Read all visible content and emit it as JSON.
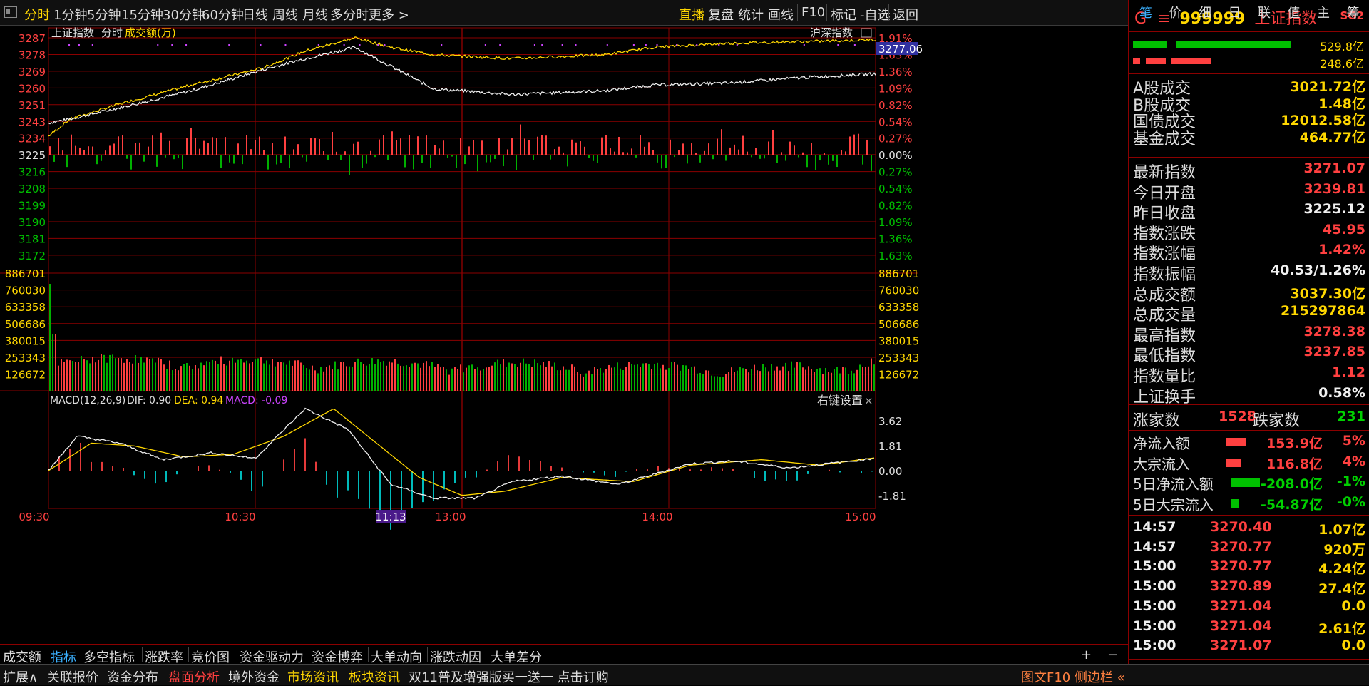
{
  "toolbar": {
    "periods": [
      "分时",
      "1分钟",
      "5分钟",
      "15分钟",
      "30分钟",
      "60分钟",
      "日线",
      "周线",
      "月线",
      "多分时",
      "更多 >"
    ],
    "right_buttons": [
      "直播",
      "复盘",
      "统计",
      "画线",
      "F10",
      "标记",
      "-自选",
      "返回"
    ]
  },
  "chart": {
    "index_name": "上证指数",
    "mode": "分时",
    "volume_label": "成交额(万)",
    "compare_label": "沪深指数",
    "current_price_tag": "3277.06",
    "price_ticks_left": [
      "3287",
      "3278",
      "3269",
      "3260",
      "3251",
      "3243",
      "3234",
      "3225",
      "3216",
      "3208",
      "3199",
      "3190",
      "3181",
      "3172"
    ],
    "pct_ticks_right": [
      "1.91%",
      "1.63%",
      "1.36%",
      "1.09%",
      "0.82%",
      "0.54%",
      "0.27%",
      "0.00%",
      "0.27%",
      "0.54%",
      "0.82%",
      "1.09%",
      "1.36%",
      "1.63%"
    ],
    "volume_ticks": [
      "886701",
      "760030",
      "633358",
      "506686",
      "380015",
      "253343",
      "126672"
    ],
    "macd_label": "MACD(12,26,9)",
    "macd_dif": "DIF: 0.90",
    "macd_dea": "DEA: 0.94",
    "macd_macd": "MACD: -0.09",
    "macd_settings": "右键设置",
    "macd_ticks": [
      "3.62",
      "1.81",
      "0.00",
      "-1.81"
    ],
    "time_labels": [
      "09:30",
      "10:30",
      "11:13",
      "13:00",
      "14:00",
      "15:00"
    ],
    "colors": {
      "up": "#ff4040",
      "down": "#00b000",
      "line_white": "#f0f0f0",
      "line_yellow": "#ffd700",
      "grid": "#8b0000",
      "macd_neg": "#00d0d0",
      "purple": "#cc44ff"
    }
  },
  "right_panel": {
    "code_prefix": "G",
    "code": "999999",
    "name": "上证指数",
    "tag": "SG2",
    "top_bar_values": [
      "529.8亿",
      "248.6亿"
    ],
    "turnover": [
      {
        "label": "A股成交",
        "value": "3021.72亿"
      },
      {
        "label": "B股成交",
        "value": "1.48亿"
      },
      {
        "label": "国债成交",
        "value": "12012.58亿"
      },
      {
        "label": "基金成交",
        "value": "464.77亿"
      }
    ],
    "stats": [
      {
        "label": "最新指数",
        "value": "3271.07",
        "color": "red"
      },
      {
        "label": "今日开盘",
        "value": "3239.81",
        "color": "red"
      },
      {
        "label": "昨日收盘",
        "value": "3225.12",
        "color": "white"
      },
      {
        "label": "指数涨跌",
        "value": "45.95",
        "color": "red"
      },
      {
        "label": "指数涨幅",
        "value": "1.42%",
        "color": "red"
      },
      {
        "label": "指数振幅",
        "value": "40.53/1.26%",
        "color": "white"
      },
      {
        "label": "总成交额",
        "value": "3037.30亿",
        "color": "yellow"
      },
      {
        "label": "总成交量",
        "value": "215297864",
        "color": "yellow"
      },
      {
        "label": "最高指数",
        "value": "3278.38",
        "color": "red"
      },
      {
        "label": "最低指数",
        "value": "3237.85",
        "color": "red"
      },
      {
        "label": "指数量比",
        "value": "1.12",
        "color": "red"
      },
      {
        "label": "上证换手",
        "value": "0.58%",
        "color": "white"
      }
    ],
    "up_label": "涨家数",
    "up_count": "1528",
    "down_label": "跌家数",
    "down_count": "231",
    "flows": [
      {
        "label": "净流入额",
        "value": "153.9亿",
        "pct": "5%",
        "color": "red",
        "bar": 0.7
      },
      {
        "label": "大宗流入",
        "value": "116.8亿",
        "pct": "4%",
        "color": "red",
        "bar": 0.55
      },
      {
        "label": "5日净流入额",
        "value": "-208.0亿",
        "pct": "-1%",
        "color": "green",
        "bar": 1.0
      },
      {
        "label": "5日大宗流入",
        "value": "-54.87亿",
        "pct": "-0%",
        "color": "green",
        "bar": 0.25
      }
    ],
    "ticks": [
      {
        "time": "14:57",
        "price": "3270.40",
        "vol": "1.07亿"
      },
      {
        "time": "14:57",
        "price": "3270.77",
        "vol": "920万"
      },
      {
        "time": "15:00",
        "price": "3270.77",
        "vol": "4.24亿"
      },
      {
        "time": "15:00",
        "price": "3270.89",
        "vol": "27.4亿"
      },
      {
        "time": "15:00",
        "price": "3271.04",
        "vol": "0.0"
      },
      {
        "time": "15:00",
        "price": "3271.04",
        "vol": "2.61亿"
      },
      {
        "time": "15:00",
        "price": "3271.07",
        "vol": "0.0"
      }
    ],
    "tick_tabs": [
      "笔",
      "价",
      "细",
      "日",
      "联",
      "值",
      "主",
      "筹"
    ]
  },
  "bottom_tabs": [
    "成交额",
    "指标",
    "多空指标",
    "涨跌率",
    "竞价图",
    "资金驱动力",
    "资金博弈",
    "大单动向",
    "涨跌动因",
    "大单差分"
  ],
  "bottom_controls": [
    "+",
    "−"
  ],
  "status_bar": {
    "items": [
      "扩展∧",
      "关联报价",
      "资金分布",
      "盘面分析",
      "境外资金",
      "市场资讯",
      "板块资讯",
      "双11普及增强版买一送一 点击订购"
    ],
    "right": "图文F10 侧边栏 «"
  }
}
